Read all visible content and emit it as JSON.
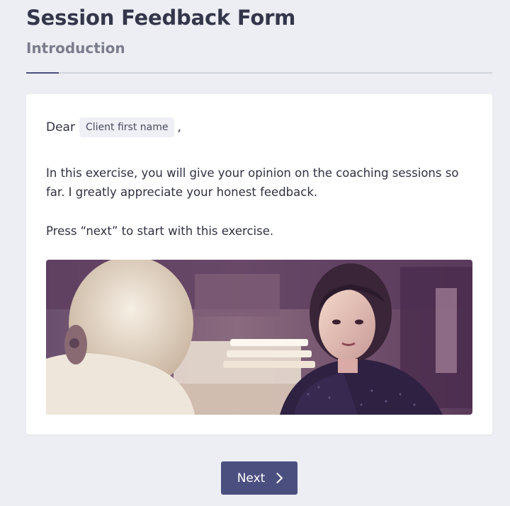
{
  "header": {
    "title": "Session Feedback Form",
    "subtitle": "Introduction"
  },
  "content": {
    "greeting_prefix": "Dear",
    "client_name_placeholder": "Client first name",
    "greeting_suffix": ",",
    "paragraph1": "In this exercise, you will give your opinion on the coaching sessions so far. I greatly appreciate your honest feedback.",
    "paragraph2": "Press “next” to start with this exercise."
  },
  "footer": {
    "next_label": "Next",
    "next_icon": "chevron-right-icon"
  },
  "colors": {
    "background": "#eceef3",
    "accent": "#4b4f80",
    "card": "#ffffff"
  }
}
